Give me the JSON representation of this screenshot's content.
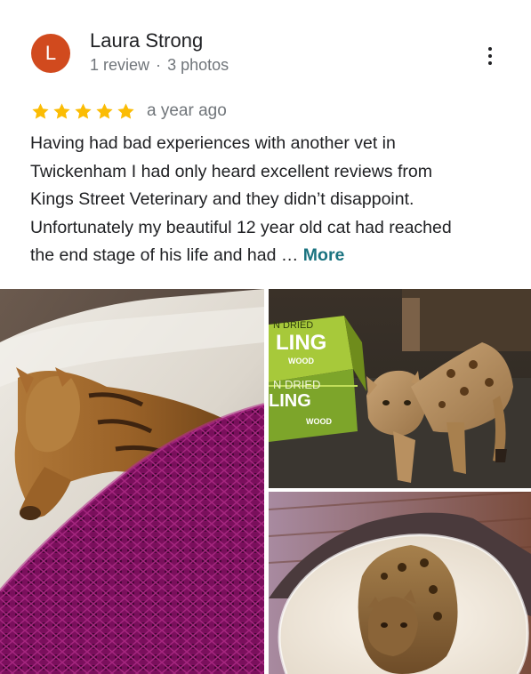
{
  "review": {
    "author": {
      "initial": "L",
      "name": "Laura Strong",
      "review_count": "1 review",
      "separator": "·",
      "photo_count": "3 photos",
      "avatar_color": "#d14a1e"
    },
    "rating": 5,
    "star_color": "#fbbc04",
    "date": "a year ago",
    "text_lines": [
      "Having had bad experiences with another vet in",
      "Twickenham I had only heard excellent reviews from",
      "Kings Street Veterinary and they didn’t disappoint.",
      "Unfortunately my beautiful 12 year old cat had reached",
      "the end stage of his life and had …"
    ],
    "more_label": "More",
    "more_color": "#1a7380",
    "photos": [
      {
        "icon": "photo-cat-under-purple-blanket"
      },
      {
        "icon": "photo-cat-beside-green-box",
        "box_text_1": "N DRIED",
        "box_text_2": "LING",
        "box_text_3": "WOOD"
      },
      {
        "icon": "photo-cat-on-sheepskin-rug"
      }
    ]
  }
}
